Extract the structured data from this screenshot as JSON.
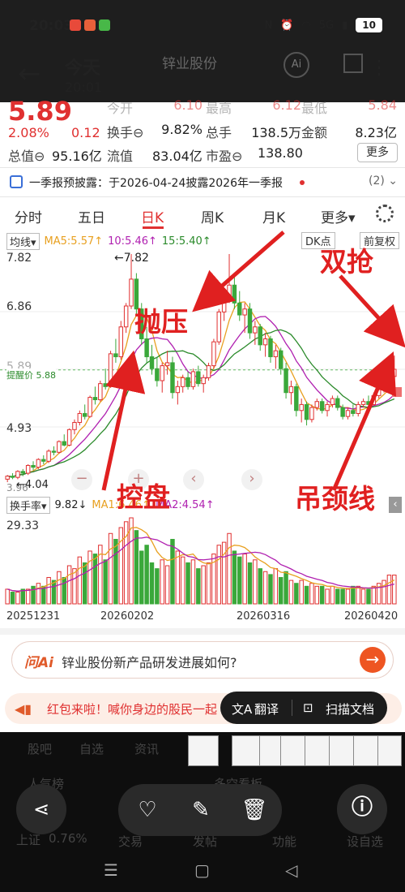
{
  "status": {
    "time": "20:03",
    "battery": "10",
    "network": "5G",
    "app_icon_colors": [
      "#e84a3a",
      "#e8603a",
      "#48b848"
    ]
  },
  "viewer": {
    "title": "今天",
    "time": "20:01",
    "back_icon": "back-arrow-icon",
    "more_icon": "more-vertical-icon"
  },
  "header_ghost": {
    "stock_name": "锌业股份",
    "ai_label": "Ai"
  },
  "quote": {
    "price": "5.89",
    "pct": "2.08%",
    "change": "0.12",
    "rows": [
      [
        {
          "label": "今开",
          "value": "6.10"
        },
        {
          "label": "最高",
          "value": "6.12"
        },
        {
          "label": "最低",
          "value": "5.84"
        }
      ],
      [
        {
          "label": "换手⊖",
          "value": "9.82%"
        },
        {
          "label": "总手",
          "value": "138.5万"
        },
        {
          "label": "金额",
          "value": "8.23亿"
        }
      ],
      [
        {
          "label": "总值⊖",
          "value": "95.16亿"
        },
        {
          "label": "流值",
          "value": "83.04亿"
        },
        {
          "label": "市盈⊖",
          "value": "138.80"
        }
      ]
    ],
    "more_label": "更多"
  },
  "announcement": {
    "text": "一季报预披露：于2026-04-24披露2026年一季报",
    "count": "(2) ⌄"
  },
  "tabs": [
    "分时",
    "五日",
    "日K",
    "周K",
    "月K",
    "更多▾"
  ],
  "active_tab": 2,
  "kline": {
    "ma_type": "均线▾",
    "ma5": "MA5:5.57↑",
    "ma10": "10:5.46↑",
    "ma15": "15:5.40↑",
    "dk_label": "DK点",
    "fq_label": "前复权",
    "y_labels": [
      "7.82",
      "6.86",
      "5.89",
      "4.93",
      "3.96"
    ],
    "max_label": "←7.82",
    "min_label": "←4.04",
    "alert_label": "提醒价 5.88",
    "zoom_minus": "−",
    "zoom_plus": "+",
    "prev": "‹",
    "next": "›"
  },
  "volume": {
    "type": "换手率▾",
    "value": "9.82↓",
    "ma1": "MA1:6.46↑",
    "ma2": "MA2:4.54↑",
    "y_label": "29.33",
    "dates": [
      "20251231",
      "20260202",
      "20260316",
      "20260420"
    ]
  },
  "annotations": {
    "paoya": "抛压",
    "shuangqiang": "双抢",
    "kongpan": "控盘",
    "diaojingxian": "吊颈线"
  },
  "ask": {
    "logo": "问Ai",
    "text": "锌业股份新产品研发进展如何?",
    "go": "→"
  },
  "promo": {
    "text": "红包来啦！喊你身边的股民一起"
  },
  "pill": {
    "translate": "翻译",
    "scan": "扫描文档"
  },
  "ghost_bottom": {
    "tabs": [
      "股吧",
      "自选",
      "资讯"
    ],
    "left": "人气榜",
    "right": "多空看板",
    "index_label": "上证",
    "index_value": "0.76%",
    "bottom_labels": [
      "交易",
      "发帖",
      "功能",
      "设自选"
    ]
  },
  "actions": {
    "share": "share-icon",
    "favorite": "heart-icon",
    "edit": "pencil-icon",
    "delete": "trash-icon",
    "info": "info-icon"
  },
  "nav": [
    "☰",
    "▢",
    "◁"
  ],
  "colors": {
    "up": "#e03030",
    "down": "#3aa83a",
    "ma5": "#e8a020",
    "ma10": "#b020b0",
    "ma15": "#2a8a2a",
    "annotation": "#e02020"
  },
  "chart_data": {
    "type": "table",
    "candles": [
      [
        4.05,
        4.12,
        4.0,
        4.1
      ],
      [
        4.1,
        4.15,
        4.05,
        4.08
      ],
      [
        4.08,
        4.2,
        4.05,
        4.18
      ],
      [
        4.18,
        4.22,
        4.1,
        4.15
      ],
      [
        4.15,
        4.3,
        4.12,
        4.28
      ],
      [
        4.28,
        4.35,
        4.2,
        4.25
      ],
      [
        4.25,
        4.4,
        4.22,
        4.38
      ],
      [
        4.38,
        4.45,
        4.3,
        4.35
      ],
      [
        4.35,
        4.55,
        4.32,
        4.52
      ],
      [
        4.52,
        4.6,
        4.45,
        4.5
      ],
      [
        4.5,
        4.7,
        4.48,
        4.68
      ],
      [
        4.68,
        4.8,
        4.6,
        4.62
      ],
      [
        4.62,
        4.9,
        4.6,
        4.88
      ],
      [
        4.88,
        5.05,
        4.8,
        5.0
      ],
      [
        5.0,
        5.2,
        4.95,
        5.15
      ],
      [
        5.15,
        5.3,
        5.05,
        5.1
      ],
      [
        5.1,
        5.45,
        5.08,
        5.42
      ],
      [
        5.42,
        5.6,
        5.3,
        5.38
      ],
      [
        5.38,
        5.7,
        5.35,
        5.65
      ],
      [
        5.65,
        5.9,
        5.55,
        5.6
      ],
      [
        5.6,
        6.2,
        5.58,
        6.15
      ],
      [
        6.15,
        6.4,
        6.0,
        6.1
      ],
      [
        6.1,
        6.7,
        6.05,
        6.6
      ],
      [
        6.6,
        7.0,
        6.5,
        6.95
      ],
      [
        6.95,
        7.82,
        6.9,
        7.4
      ],
      [
        7.4,
        7.5,
        6.8,
        6.9
      ],
      [
        6.9,
        7.0,
        6.3,
        6.4
      ],
      [
        6.4,
        6.6,
        6.0,
        6.1
      ],
      [
        6.1,
        6.3,
        5.8,
        5.9
      ],
      [
        5.9,
        6.1,
        5.6,
        5.7
      ],
      [
        5.7,
        6.0,
        5.5,
        5.95
      ],
      [
        5.95,
        6.2,
        5.8,
        6.0
      ],
      [
        6.0,
        6.1,
        5.4,
        5.5
      ],
      [
        5.5,
        5.7,
        5.3,
        5.6
      ],
      [
        5.6,
        5.8,
        5.5,
        5.75
      ],
      [
        5.75,
        5.85,
        5.55,
        5.6
      ],
      [
        5.6,
        5.9,
        5.55,
        5.85
      ],
      [
        5.85,
        5.95,
        5.6,
        5.65
      ],
      [
        5.65,
        5.8,
        5.5,
        5.75
      ],
      [
        5.75,
        6.0,
        5.7,
        5.95
      ],
      [
        5.95,
        6.4,
        5.9,
        6.35
      ],
      [
        6.35,
        6.9,
        6.3,
        6.85
      ],
      [
        6.85,
        7.2,
        6.7,
        7.1
      ],
      [
        7.1,
        7.82,
        7.0,
        7.3
      ],
      [
        7.3,
        7.5,
        6.9,
        7.0
      ],
      [
        7.0,
        7.2,
        6.7,
        6.8
      ],
      [
        6.8,
        7.0,
        6.5,
        6.9
      ],
      [
        6.9,
        7.0,
        6.4,
        6.5
      ],
      [
        6.5,
        6.7,
        6.3,
        6.6
      ],
      [
        6.6,
        6.65,
        6.2,
        6.3
      ],
      [
        6.3,
        6.5,
        6.1,
        6.4
      ],
      [
        6.4,
        6.45,
        6.0,
        6.1
      ],
      [
        6.1,
        6.3,
        5.9,
        6.2
      ],
      [
        6.2,
        6.25,
        5.8,
        5.9
      ],
      [
        5.9,
        6.0,
        5.4,
        5.5
      ],
      [
        5.5,
        5.7,
        5.3,
        5.6
      ],
      [
        5.6,
        5.65,
        5.1,
        5.2
      ],
      [
        5.2,
        5.4,
        5.0,
        5.3
      ],
      [
        5.3,
        5.35,
        4.95,
        5.05
      ],
      [
        5.05,
        5.3,
        5.0,
        5.25
      ],
      [
        5.25,
        5.4,
        5.2,
        5.35
      ],
      [
        5.35,
        5.4,
        5.15,
        5.2
      ],
      [
        5.2,
        5.35,
        5.1,
        5.3
      ],
      [
        5.3,
        5.45,
        5.25,
        5.4
      ],
      [
        5.4,
        5.45,
        5.2,
        5.25
      ],
      [
        5.25,
        5.3,
        5.05,
        5.1
      ],
      [
        5.1,
        5.25,
        5.05,
        5.2
      ],
      [
        5.2,
        5.3,
        5.1,
        5.15
      ],
      [
        5.15,
        5.35,
        5.1,
        5.3
      ],
      [
        5.3,
        5.4,
        5.25,
        5.35
      ],
      [
        5.35,
        5.45,
        5.25,
        5.3
      ],
      [
        5.3,
        5.5,
        5.28,
        5.45
      ],
      [
        5.45,
        5.6,
        5.4,
        5.55
      ],
      [
        5.55,
        5.8,
        5.5,
        5.7
      ],
      [
        5.7,
        6.12,
        5.6,
        5.77
      ],
      [
        5.77,
        6.12,
        5.84,
        5.89
      ]
    ],
    "turnover": [
      5,
      4,
      4,
      5,
      5,
      6,
      7,
      6,
      9,
      8,
      11,
      9,
      13,
      12,
      16,
      14,
      18,
      17,
      20,
      15,
      24,
      22,
      26,
      28,
      29.33,
      25,
      18,
      20,
      14,
      12,
      15,
      13,
      22,
      18,
      16,
      14,
      15,
      12,
      13,
      14,
      17,
      20,
      21,
      24,
      18,
      16,
      17,
      14,
      15,
      12,
      11,
      10,
      12,
      9,
      11,
      8,
      7,
      8,
      6,
      7,
      6,
      6,
      5,
      6,
      5,
      5,
      5,
      6,
      6,
      5,
      5,
      6,
      7,
      8,
      9.82,
      9.82
    ]
  }
}
